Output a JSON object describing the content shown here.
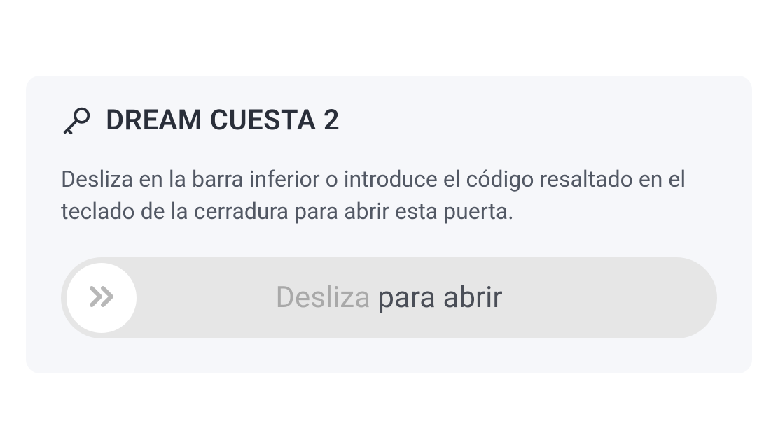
{
  "lock": {
    "name": "DREAM CUESTA 2",
    "instruction": "Desliza en la barra inferior o introduce el código resaltado en el teclado de la cerradura para abrir esta puerta."
  },
  "slider": {
    "label_light": "Desliza",
    "label_dark": " para abrir"
  }
}
